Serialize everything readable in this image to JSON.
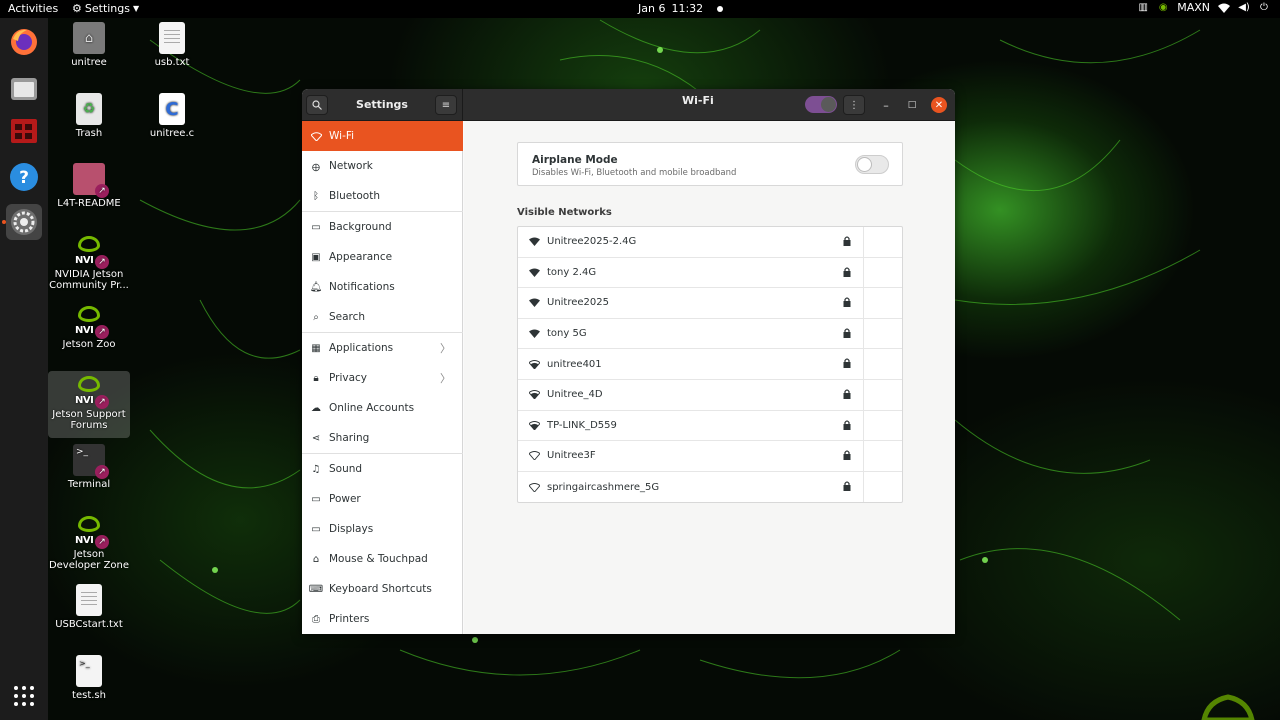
{
  "topbar": {
    "activities": "Activities",
    "app_menu": "Settings",
    "date": "Jan 6",
    "time": "11:32",
    "power_mode": "MAXN"
  },
  "desktop": {
    "icons": [
      {
        "label": "unitree"
      },
      {
        "label": "usb.txt"
      },
      {
        "label": "Trash"
      },
      {
        "label": "unitree.c"
      },
      {
        "label": "L4T-README"
      },
      {
        "label": "NVIDIA Jetson Community Pr..."
      },
      {
        "label": "Jetson Zoo"
      },
      {
        "label": "Jetson Support Forums"
      },
      {
        "label": "Terminal"
      },
      {
        "label": "Jetson Developer Zone"
      },
      {
        "label": "USBCstart.txt"
      },
      {
        "label": "test.sh"
      }
    ]
  },
  "window": {
    "sidebar_title": "Settings",
    "panel_title": "Wi-Fi",
    "sidebar": {
      "items": [
        {
          "label": "Wi-Fi",
          "icon": "wifi-icon"
        },
        {
          "label": "Network",
          "icon": "network-icon"
        },
        {
          "label": "Bluetooth",
          "icon": "bluetooth-icon"
        },
        {
          "label": "Background",
          "icon": "background-icon"
        },
        {
          "label": "Appearance",
          "icon": "appearance-icon"
        },
        {
          "label": "Notifications",
          "icon": "bell-icon"
        },
        {
          "label": "Search",
          "icon": "search-icon"
        },
        {
          "label": "Applications",
          "icon": "applications-icon"
        },
        {
          "label": "Privacy",
          "icon": "privacy-icon"
        },
        {
          "label": "Online Accounts",
          "icon": "cloud-icon"
        },
        {
          "label": "Sharing",
          "icon": "share-icon"
        },
        {
          "label": "Sound",
          "icon": "music-note-icon"
        },
        {
          "label": "Power",
          "icon": "power-icon"
        },
        {
          "label": "Displays",
          "icon": "display-icon"
        },
        {
          "label": "Mouse & Touchpad",
          "icon": "mouse-icon"
        },
        {
          "label": "Keyboard Shortcuts",
          "icon": "keyboard-icon"
        },
        {
          "label": "Printers",
          "icon": "printer-icon"
        }
      ]
    },
    "airplane": {
      "title": "Airplane Mode",
      "subtitle": "Disables Wi-Fi, Bluetooth and mobile broadband"
    },
    "visible_networks_title": "Visible Networks",
    "networks": [
      {
        "ssid": "Unitree2025-2.4G",
        "strength": "strong"
      },
      {
        "ssid": "tony 2.4G",
        "strength": "strong"
      },
      {
        "ssid": "Unitree2025",
        "strength": "strong"
      },
      {
        "ssid": "tony 5G",
        "strength": "strong"
      },
      {
        "ssid": "unitree401",
        "strength": "medium"
      },
      {
        "ssid": "Unitree_4D",
        "strength": "medium"
      },
      {
        "ssid": "TP-LINK_D559",
        "strength": "medium"
      },
      {
        "ssid": "Unitree3F",
        "strength": "weak"
      },
      {
        "ssid": "springaircashmere_5G",
        "strength": "weak"
      }
    ]
  },
  "colors": {
    "accent": "#e95420",
    "nvidia_green": "#76b900",
    "toggle_purple": "#7d4f93"
  }
}
